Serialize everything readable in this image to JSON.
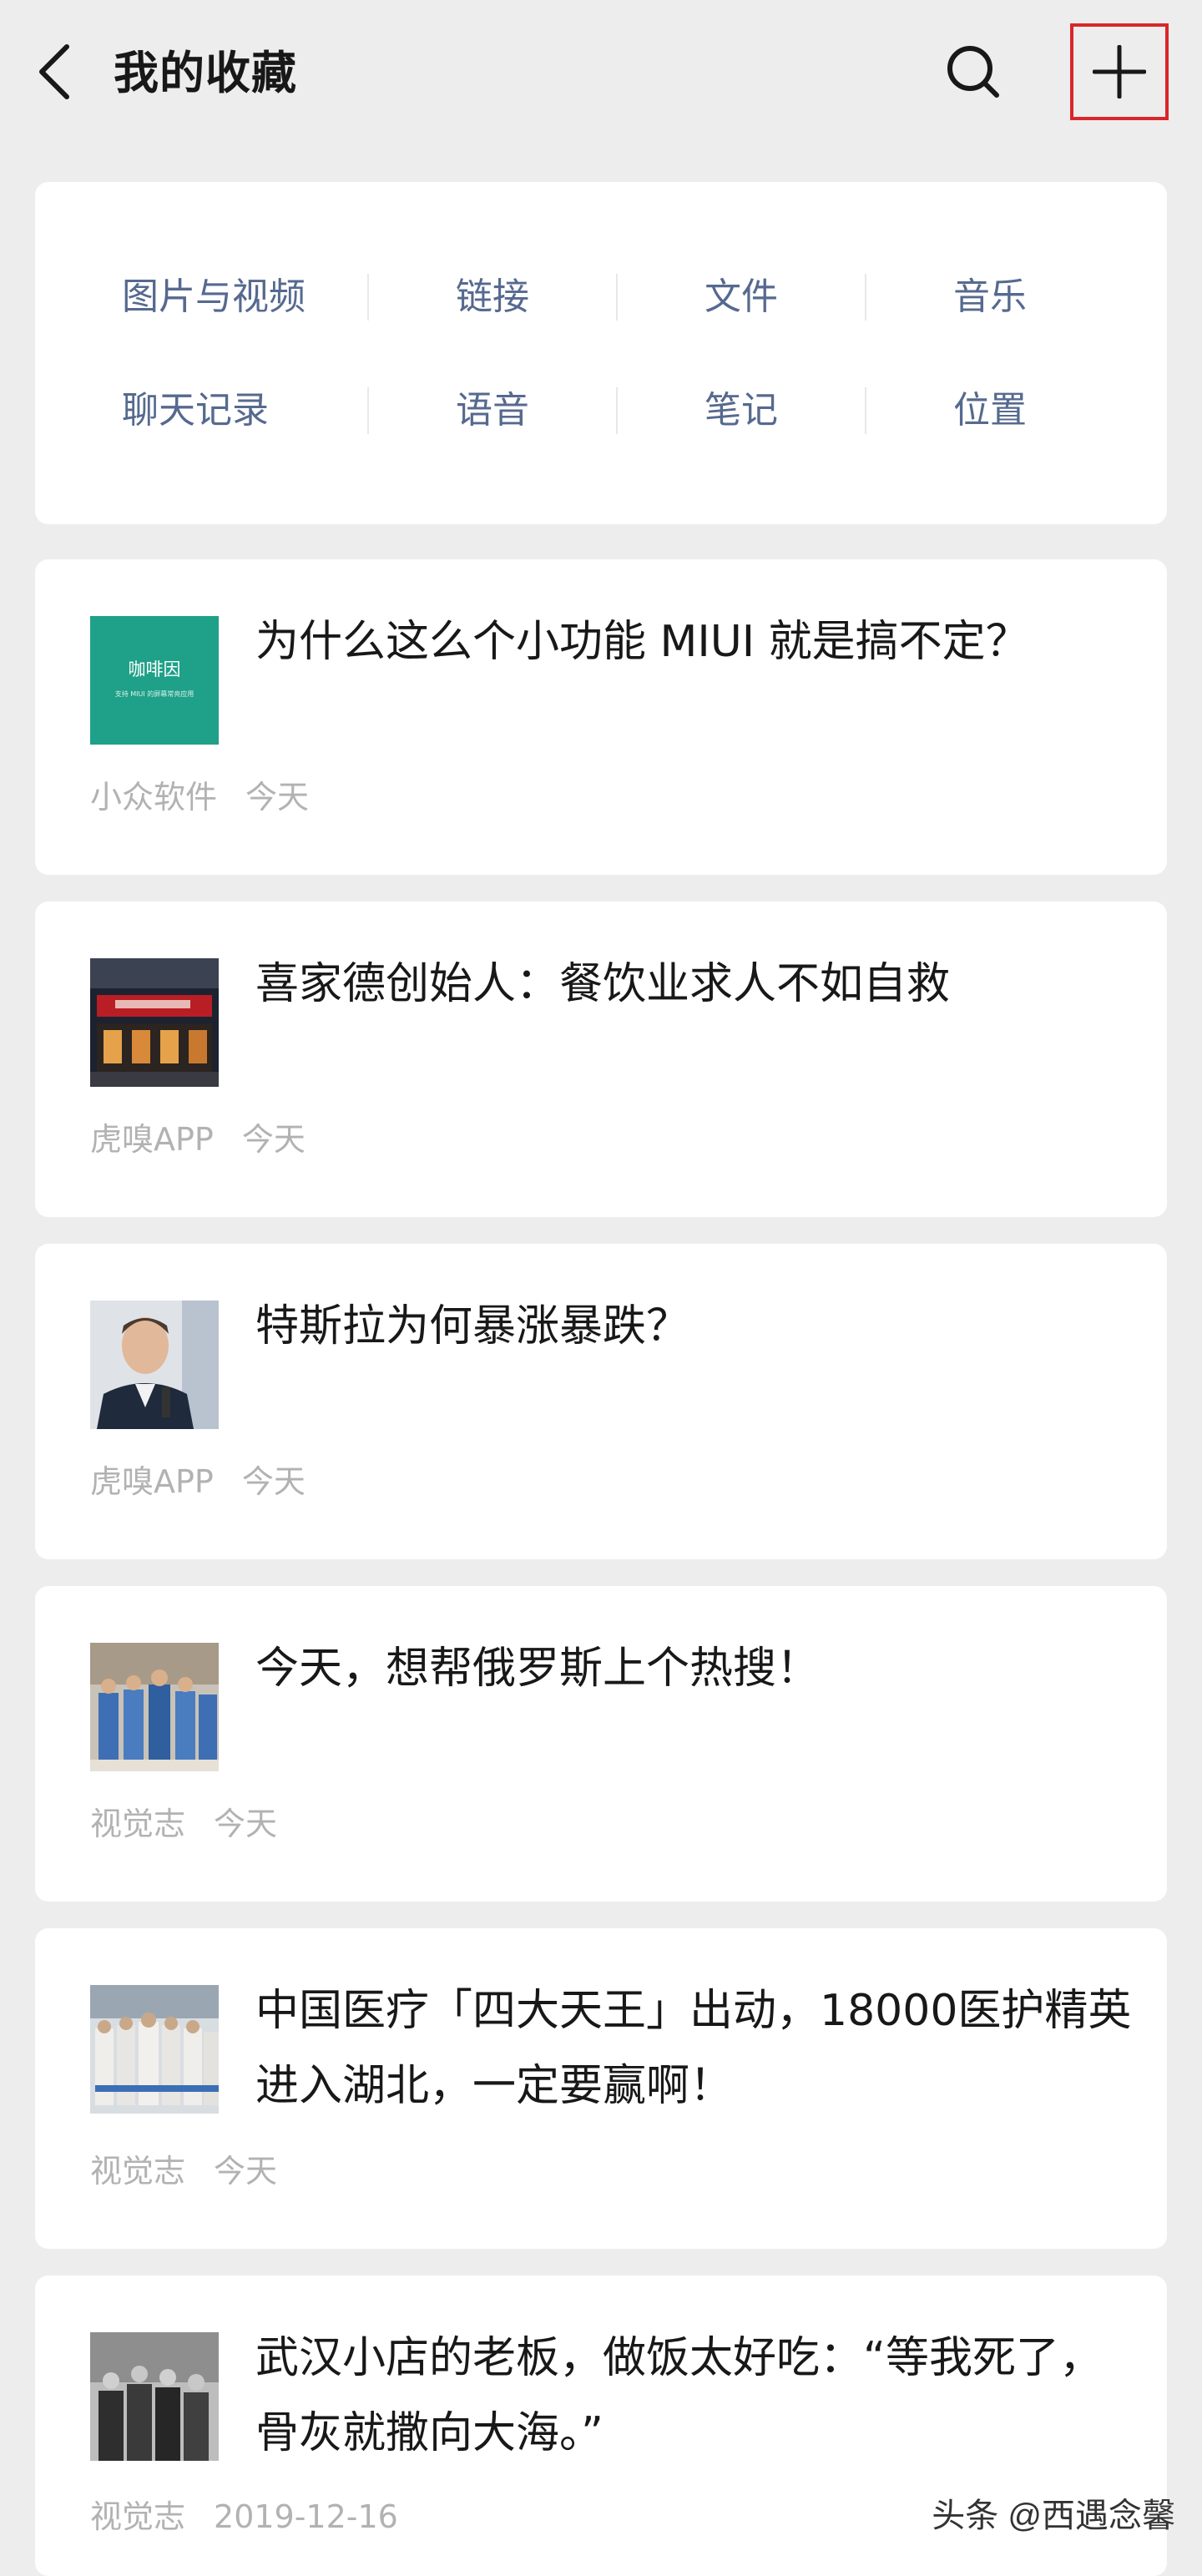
{
  "header": {
    "title": "我的收藏",
    "back_icon": "chevron-left-icon",
    "search_icon": "search-icon",
    "add_icon": "plus-icon",
    "highlight_color": "#d9262b"
  },
  "categories": [
    {
      "label": "图片与视频"
    },
    {
      "label": "链接"
    },
    {
      "label": "文件"
    },
    {
      "label": "音乐"
    },
    {
      "label": "聊天记录"
    },
    {
      "label": "语音"
    },
    {
      "label": "笔记"
    },
    {
      "label": "位置"
    }
  ],
  "favorites": [
    {
      "title": "为什么这么个小功能 MIUI 就是搞不定？",
      "source": "小众软件",
      "date": "今天",
      "thumb_text": "咖啡因",
      "thumb_subtext": "支持 MIUI 的屏幕常亮应用"
    },
    {
      "title": "喜家德创始人：餐饮业求人不如自救",
      "source": "虎嗅APP",
      "date": "今天"
    },
    {
      "title": "特斯拉为何暴涨暴跌？",
      "source": "虎嗅APP",
      "date": "今天"
    },
    {
      "title": "今天，想帮俄罗斯上个热搜！",
      "source": "视觉志",
      "date": "今天"
    },
    {
      "title": "中国医疗「四大天王」出动，18000医护精英进入湖北，一定要赢啊！",
      "source": "视觉志",
      "date": "今天"
    },
    {
      "title": "武汉小店的老板，做饭太好吃：“等我死了，骨灰就撒向大海。”",
      "source": "视觉志",
      "date": "2019-12-16"
    }
  ],
  "watermark": "头条 @西遇念馨"
}
